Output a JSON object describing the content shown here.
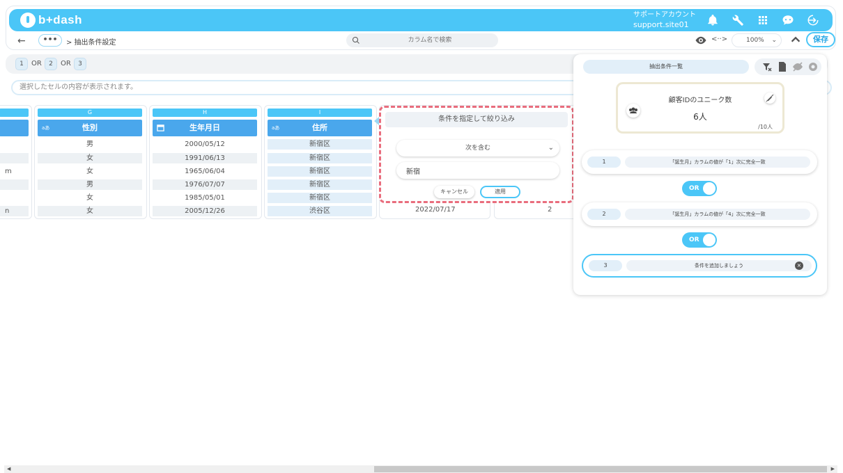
{
  "header": {
    "brand": "b+dash",
    "account_label": "サポートアカウント",
    "account_id": "support.site01"
  },
  "toolbar": {
    "back": "←",
    "more": "•••",
    "breadcrumb": "> 抽出条件設定",
    "search_placeholder": "カラム名で検索",
    "code_toggle": "<··>",
    "zoom": "100%",
    "save": "保存"
  },
  "condition_chips": [
    {
      "num": "1",
      "op": "OR"
    },
    {
      "num": "2",
      "op": "OR"
    },
    {
      "num": "3",
      "op": ""
    }
  ],
  "cell_content_placeholder": "選択したセルの内容が表示されます。",
  "columns": [
    {
      "letter": "G",
      "title": "性別",
      "type": "aあ",
      "cells": [
        "男",
        "女",
        "女",
        "男",
        "女",
        "女"
      ]
    },
    {
      "letter": "H",
      "title": "生年月日",
      "type": "calendar",
      "cells": [
        "2000/05/12",
        "1991/06/13",
        "1965/06/04",
        "1976/07/07",
        "1985/05/01",
        "2005/12/26"
      ]
    },
    {
      "letter": "I",
      "title": "住所",
      "type": "aあ",
      "cells": [
        "新宿区",
        "新宿区",
        "新宿区",
        "新宿区",
        "新宿区",
        "渋谷区"
      ]
    }
  ],
  "partial_left_cells": [
    "m",
    "n"
  ],
  "hidden_row": {
    "date": "2022/07/17",
    "num": "2"
  },
  "filter_popup": {
    "title": "条件を指定して絞り込み",
    "operator": "次を含む",
    "value": "新宿",
    "cancel": "キャンセル",
    "apply": "適用"
  },
  "right_panel": {
    "title": "抽出条件一覧",
    "count_label": "顧客IDのユニーク数",
    "count_value": "6人",
    "count_total": "/10人",
    "conditions": [
      {
        "num": "1",
        "text": "「誕生月」カラムの値が「1」次に完全一致"
      },
      {
        "num": "2",
        "text": "「誕生月」カラムの値が「4」次に完全一致"
      },
      {
        "num": "3",
        "text": "条件を追加しましょう"
      }
    ],
    "or_label": "OR"
  }
}
